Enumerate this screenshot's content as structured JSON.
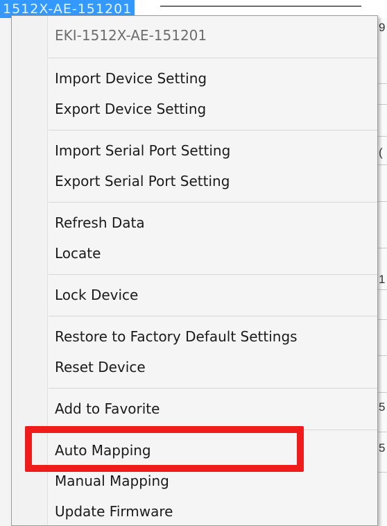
{
  "background": {
    "selected_node_label": "1512X-AE-151201",
    "right_edge_chars": [
      "9",
      "(",
      "1",
      "5",
      "5"
    ]
  },
  "context_menu": {
    "header": "EKI-1512X-AE-151201",
    "items": {
      "import_device_setting": "Import Device Setting",
      "export_device_setting": "Export Device Setting",
      "import_serial_port_setting": "Import Serial Port Setting",
      "export_serial_port_setting": "Export Serial Port Setting",
      "refresh_data": "Refresh Data",
      "locate": "Locate",
      "lock_device": "Lock Device",
      "restore_factory_defaults": "Restore to Factory Default Settings",
      "reset_device": "Reset Device",
      "add_to_favorite": "Add to Favorite",
      "auto_mapping": "Auto Mapping",
      "manual_mapping": "Manual Mapping",
      "update_firmware": "Update Firmware"
    }
  },
  "annotation": {
    "highlight_color": "#f01c1c",
    "highlighted_item": "Auto Mapping"
  }
}
